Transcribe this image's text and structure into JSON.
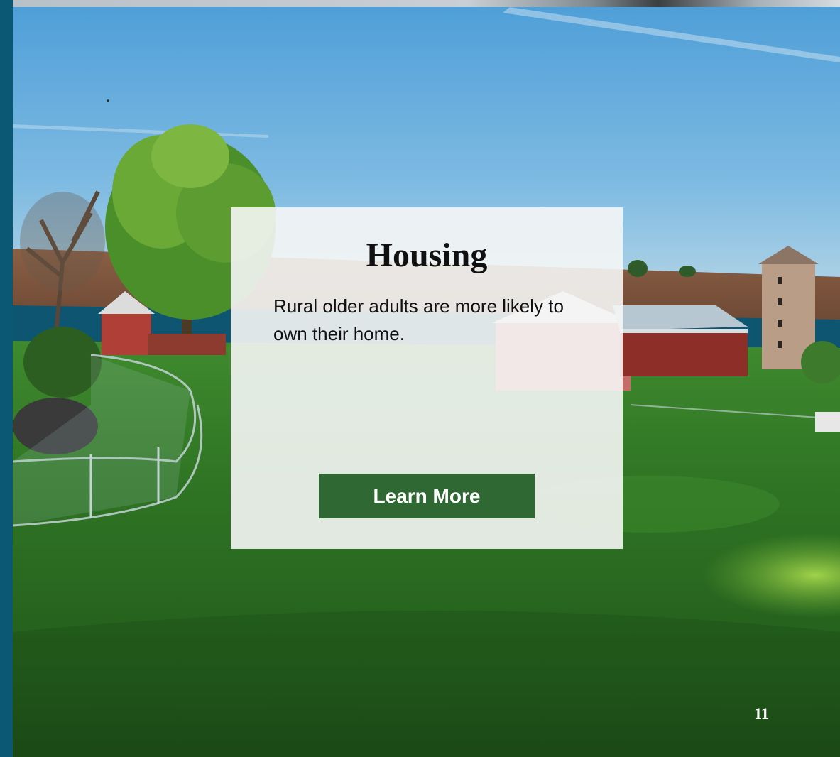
{
  "panel": {
    "title": "Housing",
    "body": "Rural older adults are more likely to own their home.",
    "button_label": "Learn More"
  },
  "footer": {
    "page_number": "11"
  },
  "colors": {
    "side_bar": "#0a5873",
    "button_background": "#306833",
    "panel_background": "#f5f6f5",
    "page_number": "#ffffff"
  }
}
